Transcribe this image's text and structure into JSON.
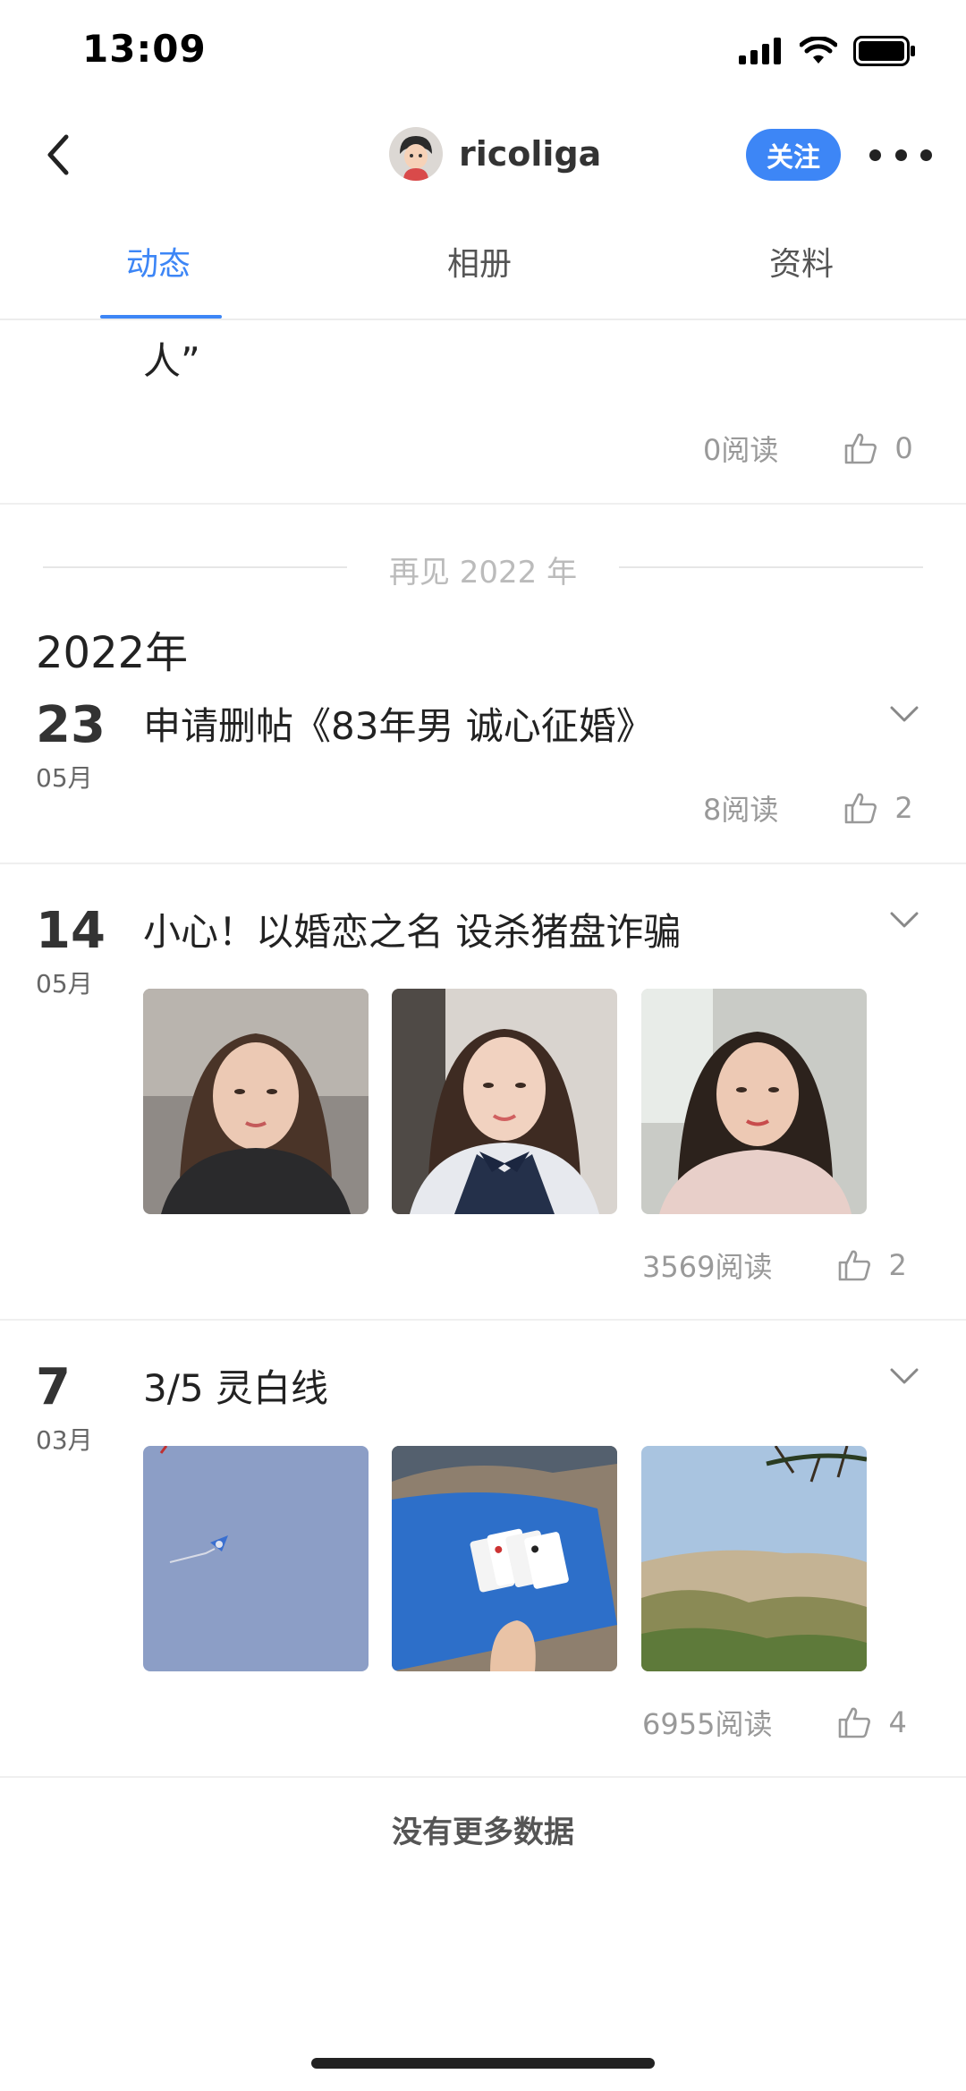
{
  "status_bar": {
    "time": "13:09"
  },
  "header": {
    "username": "ricoliga",
    "follow_label": "关注"
  },
  "tabs": [
    {
      "label": "动态",
      "active": true
    },
    {
      "label": "相册",
      "active": false
    },
    {
      "label": "资料",
      "active": false
    }
  ],
  "previous_post": {
    "text_tail": "人”",
    "reads": "0阅读",
    "likes": "0"
  },
  "year_separator": "再见 2022 年",
  "year_heading": "2022年",
  "posts": [
    {
      "day": "23",
      "month": "05月",
      "title": "申请删帖《83年男 诚心征婚》",
      "reads": "8阅读",
      "likes": "2"
    },
    {
      "day": "14",
      "month": "05月",
      "title": "小心！以婚恋之名 设杀猪盘诈骗",
      "reads": "3569阅读",
      "likes": "2"
    },
    {
      "day": "7",
      "month": "03月",
      "title": "3/5 灵白线",
      "reads": "6955阅读",
      "likes": "4"
    }
  ],
  "footer": "没有更多数据",
  "colors": {
    "accent": "#3d86f6",
    "muted": "#999999"
  }
}
